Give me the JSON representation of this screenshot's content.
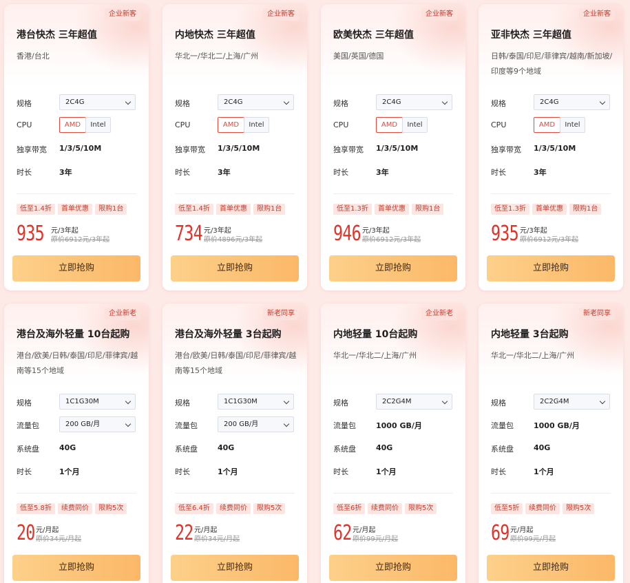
{
  "cards": [
    {
      "badge": "企业新客",
      "title": "港台快杰 三年超值",
      "region": "香港/台北",
      "labels": [
        "规格",
        "CPU",
        "独享带宽",
        "时长"
      ],
      "spec": "2C4G",
      "cpu_amd": "AMD",
      "cpu_intel": "Intel",
      "bandwidth": "1/3/5/10M",
      "duration": "3年",
      "tags": [
        "低至1.4折",
        "首单优惠",
        "限购1台"
      ],
      "price": "935",
      "unit": "元/3年起",
      "orig": "原价6912元/3年起",
      "buy": "立即抢购"
    },
    {
      "badge": "企业新客",
      "title": "内地快杰 三年超值",
      "region": "华北一/华北二/上海/广州",
      "labels": [
        "规格",
        "CPU",
        "独享带宽",
        "时长"
      ],
      "spec": "2C4G",
      "cpu_amd": "AMD",
      "cpu_intel": "Intel",
      "bandwidth": "1/3/5/10M",
      "duration": "3年",
      "tags": [
        "低至1.4折",
        "首单优惠",
        "限购1台"
      ],
      "price": "734",
      "unit": "元/3年起",
      "orig": "原价4896元/3年起",
      "buy": "立即抢购"
    },
    {
      "badge": "企业新客",
      "title": "欧美快杰 三年超值",
      "region": "美国/英国/德国",
      "labels": [
        "规格",
        "CPU",
        "独享带宽",
        "时长"
      ],
      "spec": "2C4G",
      "cpu_amd": "AMD",
      "cpu_intel": "Intel",
      "bandwidth": "1/3/5/10M",
      "duration": "3年",
      "tags": [
        "低至1.3折",
        "首单优惠",
        "限购1台"
      ],
      "price": "946",
      "unit": "元/3年起",
      "orig": "原价6912元/3年起",
      "buy": "立即抢购"
    },
    {
      "badge": "企业新客",
      "title": "亚非快杰 三年超值",
      "region": "日韩/泰国/印尼/菲律宾/越南/新加坡/印度等9个地域",
      "labels": [
        "规格",
        "CPU",
        "独享带宽",
        "时长"
      ],
      "spec": "2C4G",
      "cpu_amd": "AMD",
      "cpu_intel": "Intel",
      "bandwidth": "1/3/5/10M",
      "duration": "3年",
      "tags": [
        "低至1.3折",
        "首单优惠",
        "限购1台"
      ],
      "price": "935",
      "unit": "元/3年起",
      "orig": "原价6912元/3年起",
      "buy": "立即抢购"
    },
    {
      "badge": "企业新老",
      "title": "港台及海外轻量 10台起购",
      "region": "港台/欧美/日韩/泰国/印尼/菲律宾/越南等15个地域",
      "labels": [
        "规格",
        "流量包",
        "系统盘",
        "时长"
      ],
      "spec": "1C1G30M",
      "traffic": "200 GB/月",
      "traffic_select": true,
      "disk": "40G",
      "duration": "1个月",
      "tags": [
        "低至5.8折",
        "续费同价",
        "限购5次"
      ],
      "price": "20",
      "unit": "元/月起",
      "orig": "原价34元/月起",
      "buy": "立即抢购"
    },
    {
      "badge": "新老同享",
      "title": "港台及海外轻量 3台起购",
      "region": "港台/欧美/日韩/泰国/印尼/菲律宾/越南等15个地域",
      "labels": [
        "规格",
        "流量包",
        "系统盘",
        "时长"
      ],
      "spec": "1C1G30M",
      "traffic": "200 GB/月",
      "traffic_select": true,
      "disk": "40G",
      "duration": "1个月",
      "tags": [
        "低至6.4折",
        "续费同价",
        "限购5次"
      ],
      "price": "22",
      "unit": "元/月起",
      "orig": "原价34元/月起",
      "buy": "立即抢购"
    },
    {
      "badge": "企业新老",
      "title": "内地轻量 10台起购",
      "region": "华北一/华北二/上海/广州",
      "labels": [
        "规格",
        "流量包",
        "系统盘",
        "时长"
      ],
      "spec": "2C2G4M",
      "traffic": "1000 GB/月",
      "traffic_select": false,
      "disk": "40G",
      "duration": "1个月",
      "tags": [
        "低至6折",
        "续费同价",
        "限购5次"
      ],
      "price": "62",
      "unit": "元/月起",
      "orig": "原价99元/月起",
      "buy": "立即抢购"
    },
    {
      "badge": "新老同享",
      "title": "内地轻量 3台起购",
      "region": "华北一/华北二/上海/广州",
      "labels": [
        "规格",
        "流量包",
        "系统盘",
        "时长"
      ],
      "spec": "2C2G4M",
      "traffic": "1000 GB/月",
      "traffic_select": false,
      "disk": "40G",
      "duration": "1个月",
      "tags": [
        "低至5折",
        "续费同价",
        "限购5次"
      ],
      "price": "69",
      "unit": "元/月起",
      "orig": "原价99元/月起",
      "buy": "立即抢购"
    }
  ]
}
